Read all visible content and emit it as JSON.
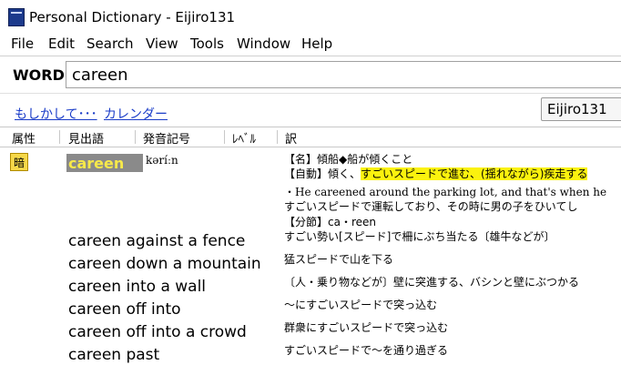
{
  "window": {
    "title": "Personal Dictionary - Eijiro131"
  },
  "menu": [
    "File",
    "Edit",
    "Search",
    "View",
    "Tools",
    "Window",
    "Help"
  ],
  "search": {
    "label": "WORD",
    "value": "careen"
  },
  "links": {
    "suggest": "もしかして･･･",
    "calendar": "カレンダー"
  },
  "dictionary_select": "Eijiro131",
  "columns": [
    "属性",
    "見出語",
    "発音記号",
    "ﾚﾍﾞﾙ",
    "訳"
  ],
  "entry": {
    "badge": "暗",
    "headword": "careen",
    "pronunciation": "kəríːn",
    "senses": {
      "noun": "【名】傾船◆船が傾くこと",
      "verb_prefix": "【自動】傾く、",
      "verb_highlight": "すごいスピードで進む、(揺れながら)疾走する",
      "example_en": "・He careened around the parking lot, and that's when he",
      "example_ja": "すごいスピードで運転しており、その時に男の子をひいてし",
      "syllab": "【分節】ca・reen"
    },
    "first_phrase_trans": "すごい勢い[スピード]で柵にぶち当たる〔雄牛などが〕"
  },
  "phrases": [
    {
      "en": "careen against a fence",
      "ja": ""
    },
    {
      "en": "careen down a mountain",
      "ja": "猛スピードで山を下る"
    },
    {
      "en": "careen into a wall",
      "ja": "〔人・乗り物などが〕壁に突進する、バシンと壁にぶつかる"
    },
    {
      "en": "careen off into",
      "ja": "～にすごいスピードで突っ込む"
    },
    {
      "en": "careen off into a crowd",
      "ja": "群衆にすごいスピードで突っ込む"
    },
    {
      "en": "careen past",
      "ja": "すごいスピードで～を通り過ぎる"
    }
  ]
}
